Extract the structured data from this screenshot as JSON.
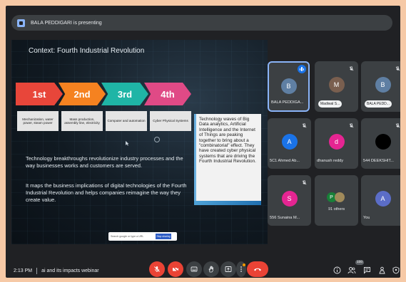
{
  "meeting": {
    "presenting_label": "BALA PEDDIGARI is presenting",
    "time": "2:13 PM",
    "title": "ai and its impacts webinar",
    "participant_count_badge": "100"
  },
  "slide": {
    "title": "Context: Fourth Industrial Revolution",
    "stages": [
      {
        "label": "1st",
        "description": "Mechanization, water power, steam power",
        "color": "#e8463a"
      },
      {
        "label": "2nd",
        "description": "Mass production, assembly line, electricity",
        "color": "#f58220"
      },
      {
        "label": "3rd",
        "description": "Computer and automation",
        "color": "#1fb5a6"
      },
      {
        "label": "4th",
        "description": "Cyber Physical Systems",
        "color": "#e04a86"
      }
    ],
    "paragraph1": "Technology breakthroughs revolutionize industry processes and the way businesses works and customers are served.",
    "paragraph2": "It maps the business implications of digital technologies of the Fourth Industrial Revolution and helps companies reimagine the way they create value.",
    "callout": "Technology waves of Big Data analytics, Artificial Intelligence and the Internet of Things are peaking together to bring about a \"combinatorial\" effect. They have created cyber physical systems that are driving the Fourth Industrial Revolution.",
    "search_placeholder": "Search google or type a URL",
    "search_button": "Stop sharing"
  },
  "participants": [
    {
      "initial": "B",
      "name": "BALA PEDDIGA...",
      "color": "#5f7fa3",
      "speaking": true
    },
    {
      "initial": "M",
      "name": "Madiwal S...",
      "color": "#7a5f4f",
      "pill": true
    },
    {
      "initial": "B",
      "name": "BALA PEDD...",
      "color": "#5f7fa3",
      "pill": true
    },
    {
      "initial": "A",
      "name": "5C1 Ahmed Ab...",
      "color": "#1a73e8"
    },
    {
      "initial": "d",
      "name": "dhanush reddy",
      "color": "#e52592"
    },
    {
      "initial": "",
      "name": "544 DEEKSHIT...",
      "color": "#000000"
    },
    {
      "initial": "S",
      "name": "556 Sunaina M...",
      "color": "#e52592"
    },
    {
      "initial": "P",
      "name": "91 others",
      "color": "#188038"
    },
    {
      "initial": "A",
      "name": "You",
      "color": "#5b6dc7"
    }
  ],
  "colors": {
    "end_call": "#ea4335",
    "muted": "#ea4335",
    "accent": "#8ab4f8"
  },
  "icons": [
    "mic-off-icon",
    "camera-off-icon",
    "captions-icon",
    "raise-hand-icon",
    "present-icon",
    "more-vert-icon",
    "call-end-icon",
    "info-icon",
    "people-icon",
    "chat-icon",
    "activities-icon",
    "host-controls-icon"
  ]
}
